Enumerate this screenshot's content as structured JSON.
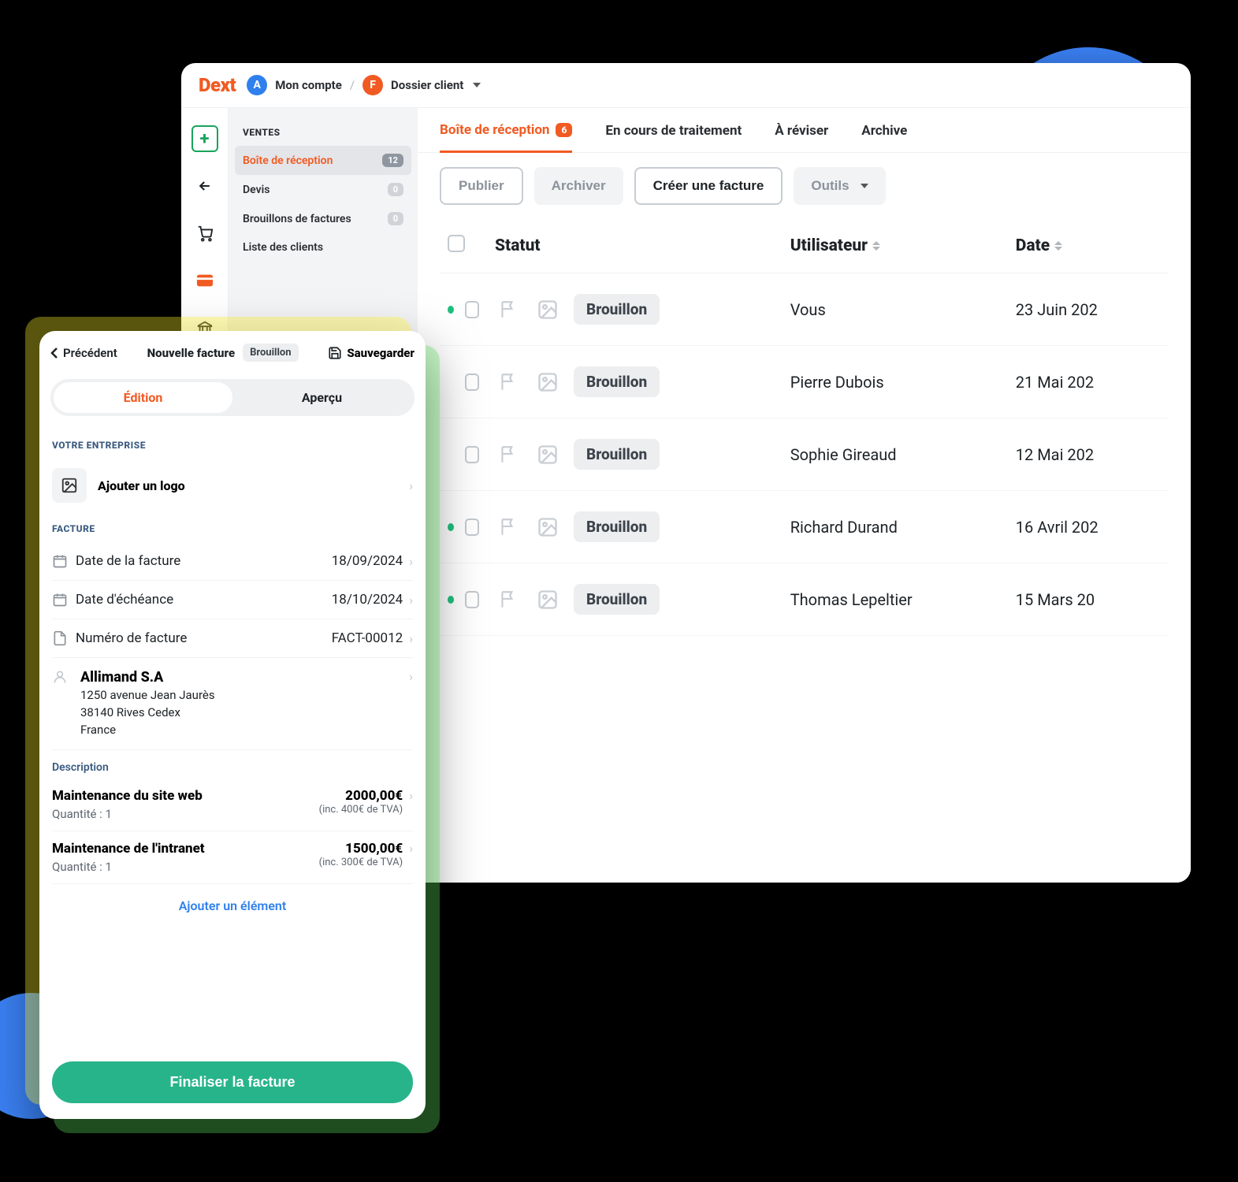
{
  "header": {
    "logo": "Dext",
    "account_initial": "A",
    "account_label": "Mon compte",
    "sep": "/",
    "dossier_initial": "F",
    "dossier_label": "Dossier client"
  },
  "sidebar": {
    "heading": "VENTES",
    "items": [
      {
        "label": "Boîte de réception",
        "badge": "12",
        "active": true
      },
      {
        "label": "Devis",
        "badge": "0",
        "active": false
      },
      {
        "label": "Brouillons de factures",
        "badge": "0",
        "active": false
      },
      {
        "label": "Liste des clients",
        "badge": "",
        "active": false
      }
    ]
  },
  "tabs": [
    {
      "label": "Boîte de réception",
      "count": "6",
      "active": true
    },
    {
      "label": "En cours de traitement",
      "count": "",
      "active": false
    },
    {
      "label": "À réviser",
      "count": "",
      "active": false
    },
    {
      "label": "Archive",
      "count": "",
      "active": false
    }
  ],
  "toolbar": {
    "publish": "Publier",
    "archive": "Archiver",
    "create": "Créer une facture",
    "tools": "Outils"
  },
  "table": {
    "headers": {
      "status": "Statut",
      "user": "Utilisateur",
      "date": "Date"
    },
    "rows": [
      {
        "dot": true,
        "status": "Brouillon",
        "user": "Vous",
        "date": "23 Juin 202"
      },
      {
        "dot": false,
        "status": "Brouillon",
        "user": "Pierre Dubois",
        "date": "21 Mai 202"
      },
      {
        "dot": false,
        "status": "Brouillon",
        "user": "Sophie Gireaud",
        "date": "12 Mai 202"
      },
      {
        "dot": true,
        "status": "Brouillon",
        "user": "Richard Durand",
        "date": "16 Avril 202"
      },
      {
        "dot": true,
        "status": "Brouillon",
        "user": "Thomas Lepeltier",
        "date": "15 Mars 20"
      }
    ]
  },
  "mobile": {
    "back": "Précédent",
    "title": "Nouvelle facture",
    "pill": "Brouillon",
    "save": "Sauvegarder",
    "tab_edit": "Édition",
    "tab_preview": "Aperçu",
    "section_company": "VOTRE ENTREPRISE",
    "add_logo": "Ajouter un logo",
    "section_invoice": "FACTURE",
    "f_date_label": "Date de la facture",
    "f_date_value": "18/09/2024",
    "f_due_label": "Date d'échéance",
    "f_due_value": "18/10/2024",
    "f_num_label": "Numéro de facture",
    "f_num_value": "FACT-00012",
    "company_name": "Allimand S.A",
    "company_addr1": "1250 avenue Jean Jaurès",
    "company_addr2": "38140 Rives Cedex",
    "company_addr3": "France",
    "desc_label": "Description",
    "items": [
      {
        "name": "Maintenance du site web",
        "qty": "Quantité : 1",
        "price": "2000,00€",
        "vat": "(inc. 400€ de TVA)"
      },
      {
        "name": "Maintenance de l'intranet",
        "qty": "Quantité : 1",
        "price": "1500,00€",
        "vat": "(inc. 300€ de TVA)"
      }
    ],
    "add_item": "Ajouter un élément",
    "finalize": "Finaliser la facture"
  }
}
